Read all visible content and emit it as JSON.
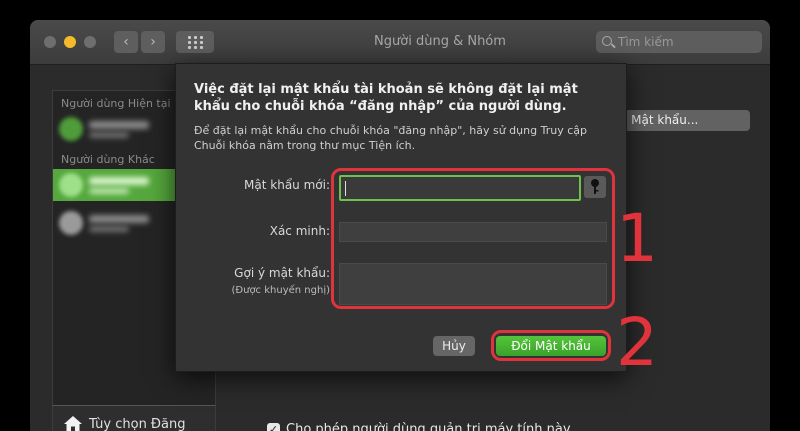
{
  "window": {
    "title": "Người dùng & Nhóm",
    "search_placeholder": "Tìm kiếm"
  },
  "sidebar": {
    "current_users_header": "Người dùng Hiện tại",
    "other_users_header": "Người dùng Khác",
    "login_options_label": "Tùy chọn Đăng nhập",
    "add_remove": "+ −"
  },
  "main": {
    "reset_password_button": "i Mật khẩu...",
    "allow_admin_label": "Cho phép người dùng quản trị máy tính này",
    "allow_admin_checked": true
  },
  "sheet": {
    "heading": "Việc đặt lại mật khẩu tài khoản sẽ không đặt lại mật khẩu cho chuỗi khóa “đăng nhập” của người dùng.",
    "description": "Để đặt lại mật khẩu cho chuỗi khóa \"đăng nhập\", hãy sử dụng Truy cập Chuỗi khóa nằm trong thư mục Tiện ích.",
    "new_password_label": "Mật khẩu mới:",
    "verify_label": "Xác minh:",
    "hint_label": "Gợi ý mật khẩu:",
    "hint_sublabel": "(Được khuyến nghị)",
    "new_password_value": "",
    "verify_value": "",
    "hint_value": "",
    "cancel_button": "Hủy",
    "change_button": "Đổi Mật khẩu"
  },
  "annotations": {
    "step1": "1",
    "step2": "2",
    "color": "#e0333b"
  },
  "colors": {
    "accent_green": "#55c43b",
    "focus_ring": "#6cc24a",
    "window_bg": "#2b2b2b"
  }
}
